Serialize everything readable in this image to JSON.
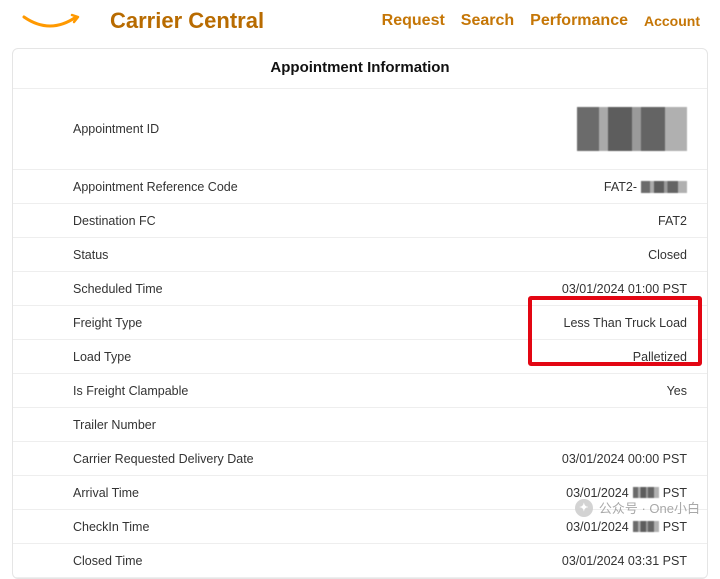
{
  "header": {
    "brand": "Carrier Central",
    "nav": {
      "request": "Request",
      "search": "Search",
      "performance": "Performance",
      "account": "Account"
    }
  },
  "panel": {
    "title": "Appointment Information",
    "rows": {
      "appointment_id": {
        "label": "Appointment ID",
        "value_redacted": true
      },
      "ref_code": {
        "label": "Appointment Reference Code",
        "value_prefix": "FAT2-",
        "value_redacted_suffix": true
      },
      "destination_fc": {
        "label": "Destination FC",
        "value": "FAT2"
      },
      "status": {
        "label": "Status",
        "value": "Closed"
      },
      "scheduled_time": {
        "label": "Scheduled Time",
        "value": "03/01/2024 01:00 PST"
      },
      "freight_type": {
        "label": "Freight Type",
        "value": "Less Than Truck Load"
      },
      "load_type": {
        "label": "Load Type",
        "value": "Palletized"
      },
      "clampable": {
        "label": "Is Freight Clampable",
        "value": "Yes"
      },
      "trailer_number": {
        "label": "Trailer Number",
        "value": ""
      },
      "crdd": {
        "label": "Carrier Requested Delivery Date",
        "value": "03/01/2024 00:00 PST"
      },
      "arrival_time": {
        "label": "Arrival Time",
        "value_prefix": "03/01/2024 ",
        "value_redacted_mid": true,
        "value_suffix": " PST"
      },
      "checkin_time": {
        "label": "CheckIn Time",
        "value_prefix": "03/01/2024 ",
        "value_redacted_mid": true,
        "value_suffix": " PST"
      },
      "closed_time": {
        "label": "Closed Time",
        "value": "03/01/2024 03:31 PST"
      }
    }
  },
  "watermark": {
    "text": "公众号 · One小白"
  }
}
